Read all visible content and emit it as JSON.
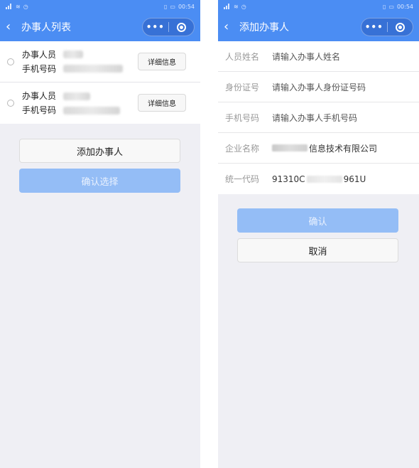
{
  "status": {
    "time": "00:54"
  },
  "left_page": {
    "title": "办事人列表",
    "persons": [
      {
        "name_label": "办事人员",
        "phone_label": "手机号码",
        "detail_label": "详细信息"
      },
      {
        "name_label": "办事人员",
        "phone_label": "手机号码",
        "detail_label": "详细信息"
      }
    ],
    "add_button": "添加办事人",
    "confirm_button": "确认选择"
  },
  "right_page": {
    "title": "添加办事人",
    "fields": [
      {
        "label": "人员姓名",
        "value": "请输入办事人姓名"
      },
      {
        "label": "身份证号",
        "value": "请输入办事人身份证号码"
      },
      {
        "label": "手机号码",
        "value": "请输入办事人手机号码"
      },
      {
        "label": "企业名称",
        "value": "信息技术有限公司"
      },
      {
        "label": "统一代码",
        "value_prefix": "91310C",
        "value_suffix": "961U"
      }
    ],
    "confirm_button": "确认",
    "cancel_button": "取消"
  },
  "colors": {
    "nav": "#4b8df3",
    "primary_disabled": "#94bdf6",
    "page_bg": "#efeff4"
  }
}
